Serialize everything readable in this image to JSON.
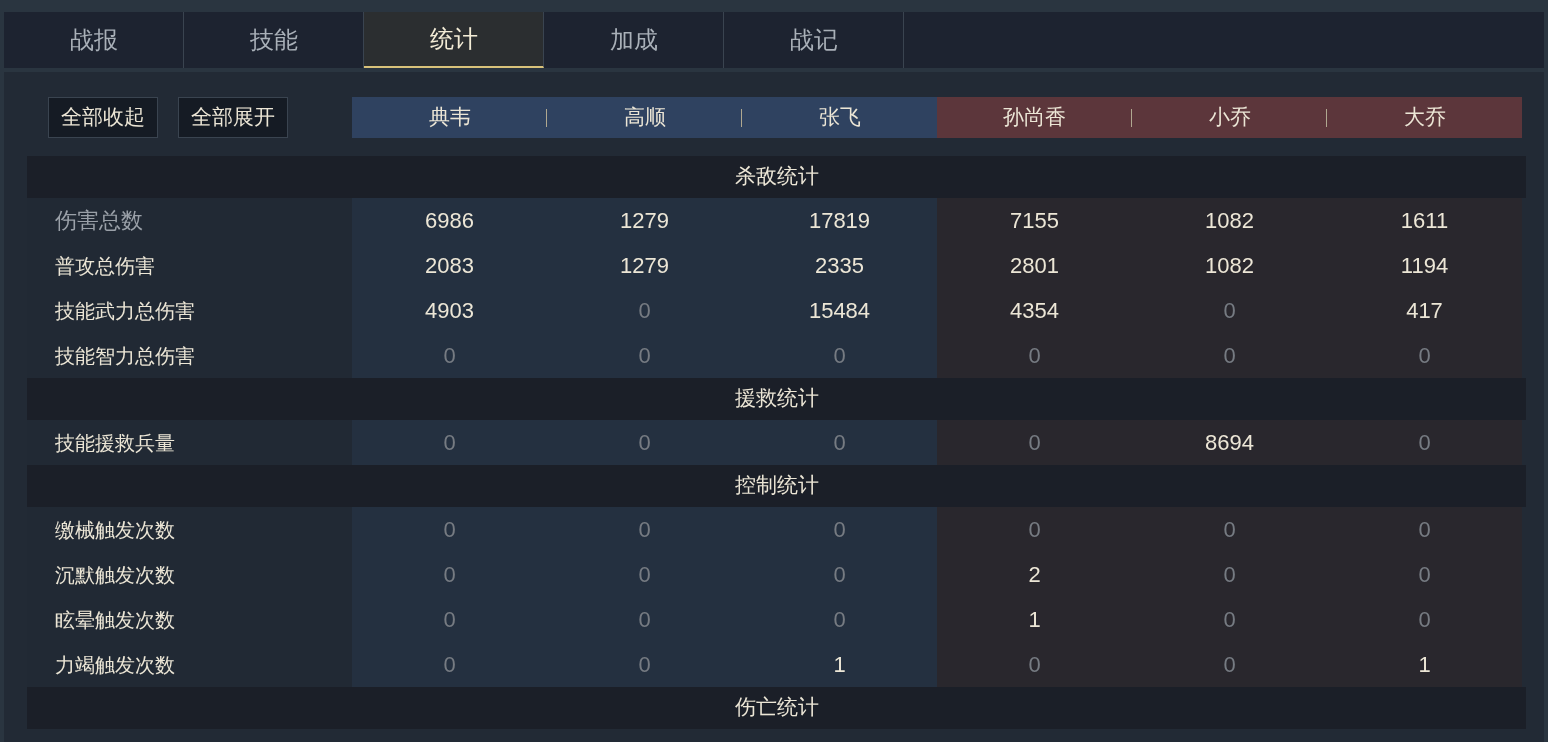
{
  "tabs": [
    {
      "label": "战报",
      "selected": false
    },
    {
      "label": "技能",
      "selected": false
    },
    {
      "label": "统计",
      "selected": true
    },
    {
      "label": "加成",
      "selected": false
    },
    {
      "label": "战记",
      "selected": false
    }
  ],
  "buttons": [
    "全部收起",
    "全部展开"
  ],
  "columns": [
    {
      "name": "典韦",
      "color": "#2f4260"
    },
    {
      "name": "高顺",
      "color": "#2f4260"
    },
    {
      "name": "张飞",
      "color": "#2f4260"
    },
    {
      "name": "孙尚香",
      "color": "#5c363b"
    },
    {
      "name": "小乔",
      "color": "#5c363b"
    },
    {
      "name": "大乔",
      "color": "#5c363b"
    }
  ],
  "sections": [
    {
      "title": "杀敌统计",
      "rows": [
        {
          "label": "伤害总数",
          "kind": "total",
          "cells": [
            {
              "text": "6986",
              "dim": false
            },
            {
              "text": "1279",
              "dim": false
            },
            {
              "text": "17819",
              "dim": false
            },
            {
              "text": "7155",
              "dim": false
            },
            {
              "text": "1082",
              "dim": false
            },
            {
              "text": "1611",
              "dim": false
            }
          ]
        },
        {
          "label": "普攻总伤害",
          "kind": "stat",
          "cells": [
            {
              "text": "2083",
              "dim": false
            },
            {
              "text": "1279",
              "dim": false
            },
            {
              "text": "2335",
              "dim": false
            },
            {
              "text": "2801",
              "dim": false
            },
            {
              "text": "1082",
              "dim": false
            },
            {
              "text": "1194",
              "dim": false
            }
          ]
        },
        {
          "label": "技能武力总伤害",
          "kind": "stat",
          "cells": [
            {
              "text": "4903",
              "dim": false
            },
            {
              "text": "0",
              "dim": true
            },
            {
              "text": "15484",
              "dim": false
            },
            {
              "text": "4354",
              "dim": false
            },
            {
              "text": "0",
              "dim": true
            },
            {
              "text": "417",
              "dim": false
            }
          ]
        },
        {
          "label": "技能智力总伤害",
          "kind": "stat",
          "cells": [
            {
              "text": "0",
              "dim": true
            },
            {
              "text": "0",
              "dim": true
            },
            {
              "text": "0",
              "dim": true
            },
            {
              "text": "0",
              "dim": true
            },
            {
              "text": "0",
              "dim": true
            },
            {
              "text": "0",
              "dim": true
            }
          ]
        }
      ]
    },
    {
      "title": "援救统计",
      "rows": [
        {
          "label": "技能援救兵量",
          "kind": "stat",
          "cells": [
            {
              "text": "0",
              "dim": true
            },
            {
              "text": "0",
              "dim": true
            },
            {
              "text": "0",
              "dim": true
            },
            {
              "text": "0",
              "dim": true
            },
            {
              "text": "8694",
              "dim": false
            },
            {
              "text": "0",
              "dim": true
            }
          ]
        }
      ]
    },
    {
      "title": "控制统计",
      "rows": [
        {
          "label": "缴械触发次数",
          "kind": "stat",
          "cells": [
            {
              "text": "0",
              "dim": true
            },
            {
              "text": "0",
              "dim": true
            },
            {
              "text": "0",
              "dim": true
            },
            {
              "text": "0",
              "dim": true
            },
            {
              "text": "0",
              "dim": true
            },
            {
              "text": "0",
              "dim": true
            }
          ]
        },
        {
          "label": "沉默触发次数",
          "kind": "stat",
          "cells": [
            {
              "text": "0",
              "dim": true
            },
            {
              "text": "0",
              "dim": true
            },
            {
              "text": "0",
              "dim": true
            },
            {
              "text": "2",
              "dim": false
            },
            {
              "text": "0",
              "dim": true
            },
            {
              "text": "0",
              "dim": true
            }
          ]
        },
        {
          "label": "眩晕触发次数",
          "kind": "stat",
          "cells": [
            {
              "text": "0",
              "dim": true
            },
            {
              "text": "0",
              "dim": true
            },
            {
              "text": "0",
              "dim": true
            },
            {
              "text": "1",
              "dim": false
            },
            {
              "text": "0",
              "dim": true
            },
            {
              "text": "0",
              "dim": true
            }
          ]
        },
        {
          "label": "力竭触发次数",
          "kind": "stat",
          "cells": [
            {
              "text": "0",
              "dim": true
            },
            {
              "text": "0",
              "dim": true
            },
            {
              "text": "1",
              "dim": false
            },
            {
              "text": "0",
              "dim": true
            },
            {
              "text": "0",
              "dim": true
            },
            {
              "text": "1",
              "dim": false
            }
          ]
        }
      ]
    },
    {
      "title": "伤亡统计"
    }
  ]
}
